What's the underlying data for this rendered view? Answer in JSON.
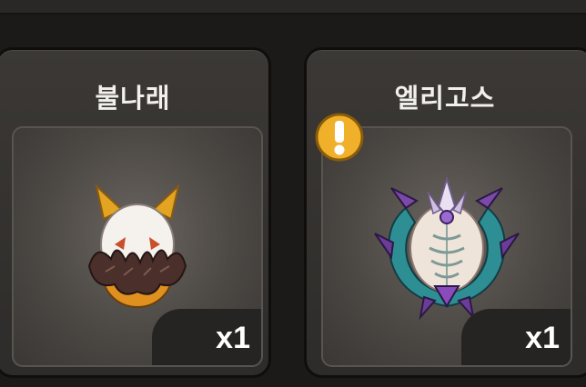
{
  "cards": [
    {
      "name": "불나래",
      "count": "x1",
      "icon": "fire-egg-icon",
      "alert": false
    },
    {
      "name": "엘리고스",
      "count": "x1",
      "icon": "crystal-dragon-egg-icon",
      "alert": true
    }
  ],
  "colors": {
    "card_bg": "#35322f",
    "slot_bg": "#5a5550",
    "alert": "#f0b02a",
    "text": "#f2f0ec"
  }
}
